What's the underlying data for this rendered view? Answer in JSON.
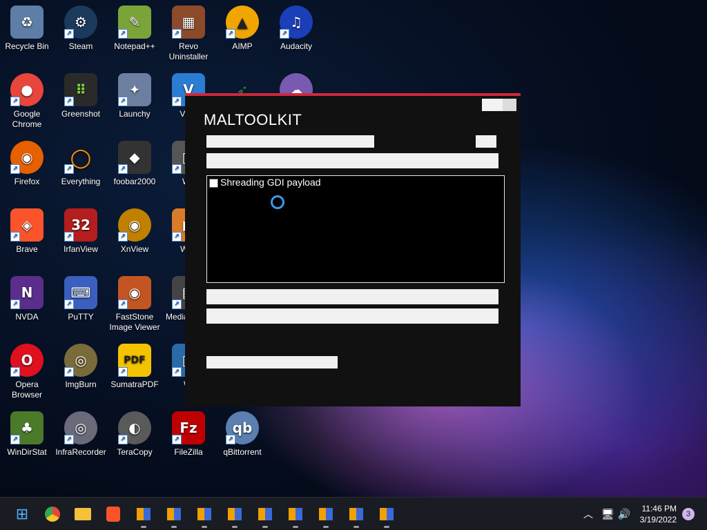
{
  "desktop": {
    "icons": [
      {
        "label": "Recycle Bin",
        "glyph": "♻",
        "color": "#5d7ea6"
      },
      {
        "label": "Steam",
        "glyph": "⚙",
        "color": "#1b3a5c"
      },
      {
        "label": "Notepad++",
        "glyph": "✎",
        "color": "#7aa33a"
      },
      {
        "label": "Revo Uninstaller",
        "glyph": "▦",
        "color": "#8d4a2a"
      },
      {
        "label": "AIMP",
        "glyph": "▲",
        "color": "#f0a500"
      },
      {
        "label": "Audacity",
        "glyph": "♫",
        "color": "#1a3fb8"
      },
      {
        "label": "Google Chrome",
        "glyph": "●",
        "color": "#e8453c"
      },
      {
        "label": "Greenshot",
        "glyph": "⠿",
        "color": "#2a2a2a"
      },
      {
        "label": "Launchy",
        "glyph": "🚀",
        "color": "#6c7fa0"
      },
      {
        "label": "VNC",
        "glyph": "V",
        "color": "#2b7cd3"
      },
      {
        "label": "Firefox",
        "glyph": "◉",
        "color": "#e66000"
      },
      {
        "label": "Everything",
        "glyph": "○",
        "color": "#f08c00"
      },
      {
        "label": "foobar2000",
        "glyph": "◆",
        "color": "#333"
      },
      {
        "label": "Wir",
        "glyph": "▣",
        "color": "#555"
      },
      {
        "label": "Brave",
        "glyph": "◈",
        "color": "#fb542b"
      },
      {
        "label": "IrfanView",
        "glyph": "32",
        "color": "#b41e1e"
      },
      {
        "label": "XnView",
        "glyph": "◉",
        "color": "#c08000"
      },
      {
        "label": "WinI",
        "glyph": "▶",
        "color": "#d97b27"
      },
      {
        "label": "NVDA",
        "glyph": "N",
        "color": "#5b2d8c"
      },
      {
        "label": "PuTTY",
        "glyph": "⌨",
        "color": "#3a5fbf"
      },
      {
        "label": "FastStone Image Viewer",
        "glyph": "◉",
        "color": "#c45522"
      },
      {
        "label": "Media Class",
        "glyph": "▤",
        "color": "#444"
      },
      {
        "label": "Opera Browser",
        "glyph": "O",
        "color": "#e0101e"
      },
      {
        "label": "ImgBurn",
        "glyph": "◎",
        "color": "#7a6b3a"
      },
      {
        "label": "SumatraPDF",
        "glyph": "PDF",
        "color": "#f3c300"
      },
      {
        "label": "Wi",
        "glyph": "▥",
        "color": "#2a6aa8"
      },
      {
        "label": "WinDirStat",
        "glyph": "♣",
        "color": "#4a7a2a"
      },
      {
        "label": "InfraRecorder",
        "glyph": "◎",
        "color": "#6a6a7a"
      },
      {
        "label": "TeraCopy",
        "glyph": "◐",
        "color": "#5a5a5a"
      },
      {
        "label": "FileZilla",
        "glyph": "Fz",
        "color": "#bf0000"
      },
      {
        "label": "qBittorrent",
        "glyph": "qb",
        "color": "#5a7fb0"
      },
      {
        "label": "",
        "glyph": "🐦",
        "color": "#2a8a4a"
      },
      {
        "label": "",
        "glyph": "💬",
        "color": "#7a5ab0"
      }
    ]
  },
  "window": {
    "title": "MALTOOLKIT",
    "checkbox_label": "Shreading GDI payload"
  },
  "taskbar": {
    "time": "11:46 PM",
    "date": "3/19/2022",
    "notifications": "3"
  }
}
